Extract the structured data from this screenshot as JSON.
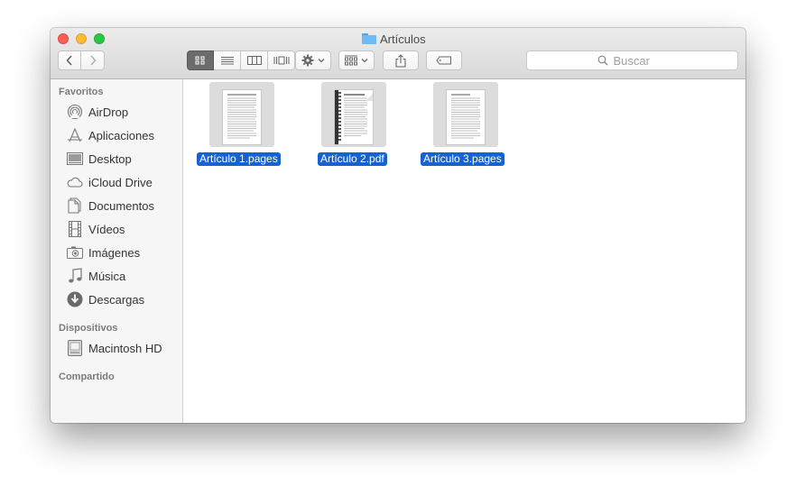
{
  "window": {
    "title": "Artículos"
  },
  "toolbar": {
    "back_icon": "chevron-left-icon",
    "forward_icon": "chevron-right-icon",
    "view_modes": [
      "icon-view-icon",
      "list-view-icon",
      "column-view-icon",
      "coverflow-view-icon"
    ],
    "action_icon": "gear-icon",
    "arrange_icon": "arrange-grid-icon",
    "share_icon": "share-icon",
    "tag_icon": "tag-icon"
  },
  "search": {
    "placeholder": "Buscar"
  },
  "sidebar": {
    "favorites_heading": "Favoritos",
    "favorites": [
      {
        "label": "AirDrop",
        "icon": "airdrop-icon"
      },
      {
        "label": "Aplicaciones",
        "icon": "applications-icon"
      },
      {
        "label": "Desktop",
        "icon": "desktop-icon"
      },
      {
        "label": "iCloud Drive",
        "icon": "cloud-icon"
      },
      {
        "label": "Documentos",
        "icon": "documents-icon"
      },
      {
        "label": "Vídeos",
        "icon": "film-icon"
      },
      {
        "label": "Imágenes",
        "icon": "camera-icon"
      },
      {
        "label": "Música",
        "icon": "music-note-icon"
      },
      {
        "label": "Descargas",
        "icon": "download-icon"
      }
    ],
    "devices_heading": "Dispositivos",
    "devices": [
      {
        "label": "Macintosh HD",
        "icon": "hard-drive-icon"
      }
    ],
    "shared_heading": "Compartido"
  },
  "files": [
    {
      "name": "Artículo 1.pages",
      "selected": true
    },
    {
      "name": "Artículo 2.pdf",
      "selected": true
    },
    {
      "name": "Artículo 3.pages",
      "selected": true
    }
  ],
  "colors": {
    "selection": "#1563d2",
    "folder": "#6fbaf0",
    "close": "#fc5f57",
    "minimize": "#fdbc2e",
    "zoom": "#28c840"
  }
}
